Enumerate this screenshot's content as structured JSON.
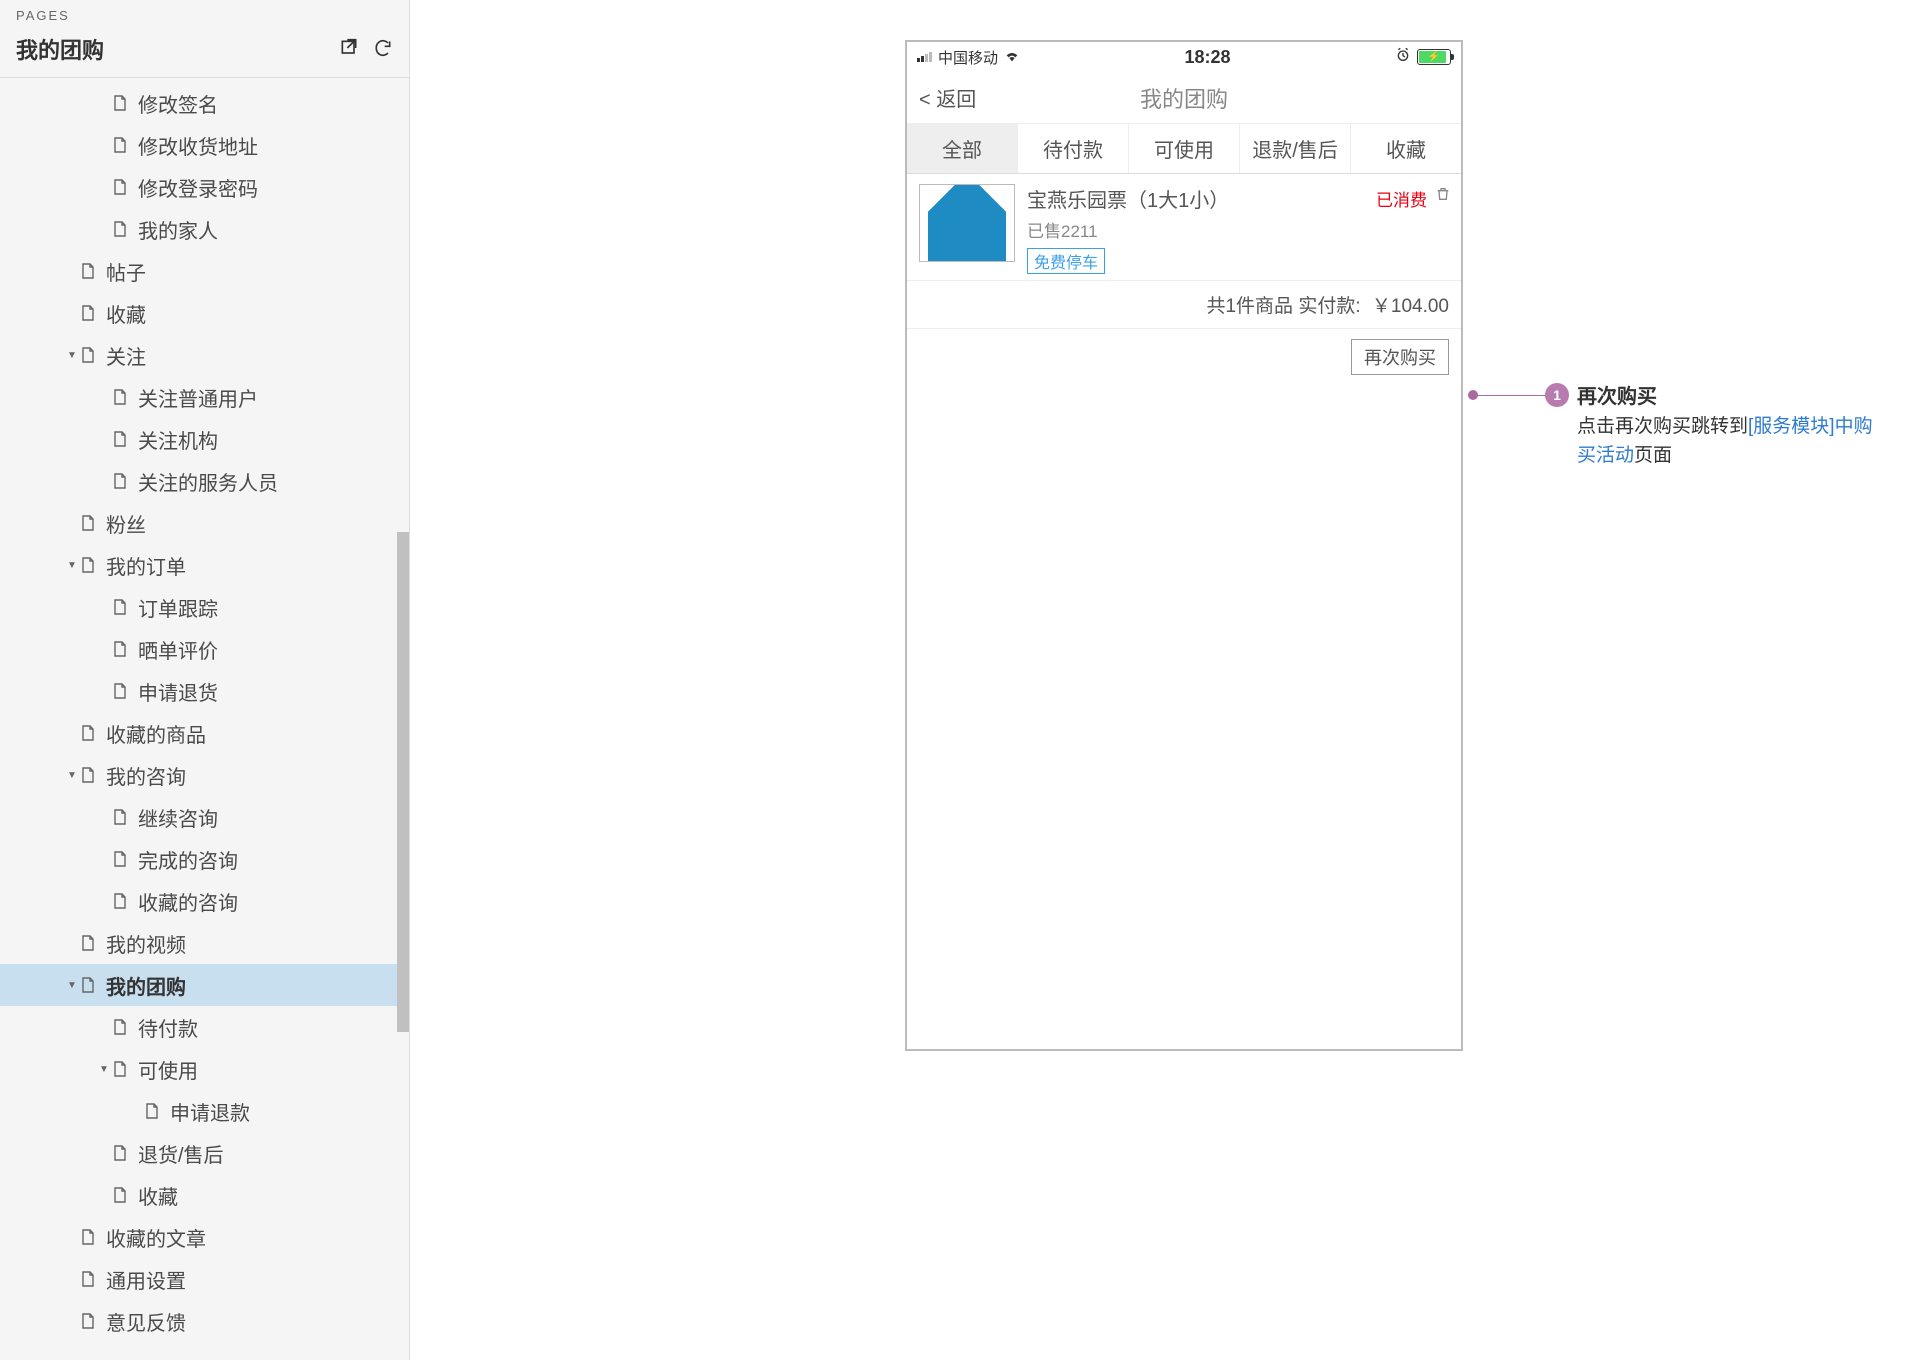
{
  "sidebar": {
    "label": "PAGES",
    "title": "我的团购",
    "items": [
      {
        "indent": 3,
        "arrow": "",
        "label": "修改签名"
      },
      {
        "indent": 3,
        "arrow": "",
        "label": "修改收货地址"
      },
      {
        "indent": 3,
        "arrow": "",
        "label": "修改登录密码"
      },
      {
        "indent": 3,
        "arrow": "",
        "label": "我的家人"
      },
      {
        "indent": 2,
        "arrow": "",
        "label": "帖子"
      },
      {
        "indent": 2,
        "arrow": "",
        "label": "收藏"
      },
      {
        "indent": 2,
        "arrow": "▼",
        "label": "关注"
      },
      {
        "indent": 3,
        "arrow": "",
        "label": "关注普通用户"
      },
      {
        "indent": 3,
        "arrow": "",
        "label": "关注机构"
      },
      {
        "indent": 3,
        "arrow": "",
        "label": "关注的服务人员"
      },
      {
        "indent": 2,
        "arrow": "",
        "label": "粉丝"
      },
      {
        "indent": 2,
        "arrow": "▼",
        "label": "我的订单"
      },
      {
        "indent": 3,
        "arrow": "",
        "label": "订单跟踪"
      },
      {
        "indent": 3,
        "arrow": "",
        "label": "晒单评价"
      },
      {
        "indent": 3,
        "arrow": "",
        "label": "申请退货"
      },
      {
        "indent": 2,
        "arrow": "",
        "label": "收藏的商品"
      },
      {
        "indent": 2,
        "arrow": "▼",
        "label": "我的咨询"
      },
      {
        "indent": 3,
        "arrow": "",
        "label": "继续咨询"
      },
      {
        "indent": 3,
        "arrow": "",
        "label": "完成的咨询"
      },
      {
        "indent": 3,
        "arrow": "",
        "label": "收藏的咨询"
      },
      {
        "indent": 2,
        "arrow": "",
        "label": "我的视频"
      },
      {
        "indent": 2,
        "arrow": "▼",
        "label": "我的团购",
        "selected": true
      },
      {
        "indent": 3,
        "arrow": "",
        "label": "待付款"
      },
      {
        "indent": 3,
        "arrow": "▼",
        "label": "可使用"
      },
      {
        "indent": 4,
        "arrow": "",
        "label": "申请退款"
      },
      {
        "indent": 3,
        "arrow": "",
        "label": "退货/售后"
      },
      {
        "indent": 3,
        "arrow": "",
        "label": "收藏"
      },
      {
        "indent": 2,
        "arrow": "",
        "label": "收藏的文章"
      },
      {
        "indent": 2,
        "arrow": "",
        "label": "通用设置"
      },
      {
        "indent": 2,
        "arrow": "",
        "label": "意见反馈"
      }
    ]
  },
  "phone": {
    "statusbar": {
      "carrier": "中国移动",
      "time": "18:28"
    },
    "nav": {
      "back": "< 返回",
      "title": "我的团购"
    },
    "tabs": [
      "全部",
      "待付款",
      "可使用",
      "退款/售后",
      "收藏"
    ],
    "active_tab": 0,
    "order": {
      "title": "宝燕乐园票（1大1小）",
      "sold": "已售2211",
      "tag": "免费停车",
      "status": "已消费",
      "summary": "共1件商品 实付款:",
      "price": "￥104.00",
      "rebuy": "再次购买"
    }
  },
  "annotation": {
    "num": "1",
    "title": "再次购买",
    "desc_pre": "点击再次购买跳转到",
    "link": "[服务模块]中购买活动",
    "desc_post": "页面"
  }
}
